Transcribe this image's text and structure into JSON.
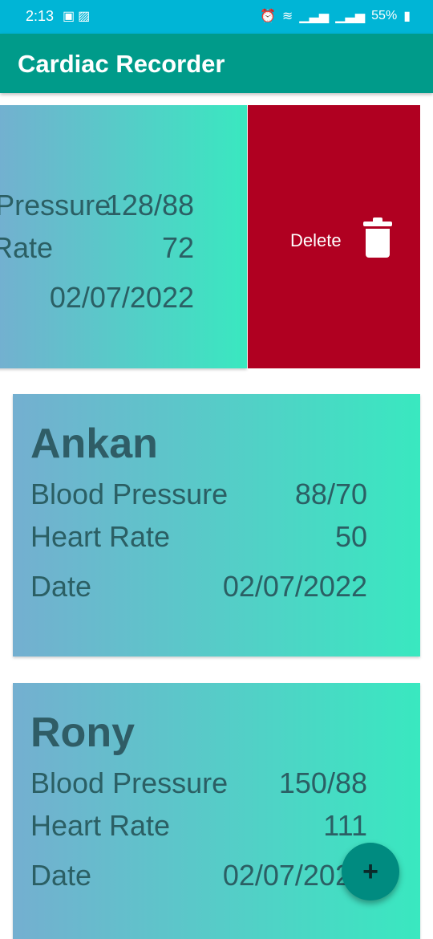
{
  "status_bar": {
    "time": "2:13",
    "left_icons": [
      "sim-icon",
      "image-icon"
    ],
    "right_icons": [
      "alarm-icon",
      "wifi-icon",
      "signal-icon",
      "signal-icon",
      "battery-icon"
    ],
    "battery": "55%"
  },
  "app_bar": {
    "title": "Cardiac Recorder"
  },
  "swiped_record": {
    "bp_label": "Blood Pressure",
    "bp_value": "128/88",
    "hr_label": "Heart Rate",
    "hr_value": "72",
    "date_value": "02/07/2022"
  },
  "delete_action": {
    "label": "Delete",
    "icon": "trash-icon"
  },
  "records": [
    {
      "name": "Ankan",
      "bp_label": "Blood Pressure",
      "bp_value": "88/70",
      "hr_label": "Heart Rate",
      "hr_value": "50",
      "date_label": "Date",
      "date_value": "02/07/2022"
    },
    {
      "name": "Rony",
      "bp_label": "Blood Pressure",
      "bp_value": "150/88",
      "hr_label": "Heart Rate",
      "hr_value": "111",
      "date_label": "Date",
      "date_value": "02/07/2022"
    }
  ],
  "fab": {
    "label": "+",
    "icon": "plus-icon"
  },
  "colors": {
    "status_bar": "#00b5d6",
    "app_bar": "#009b8a",
    "delete": "#b00021",
    "card_gradient_start": "#74afd0",
    "card_gradient_end": "#39e8c0",
    "fab": "#008b80"
  }
}
